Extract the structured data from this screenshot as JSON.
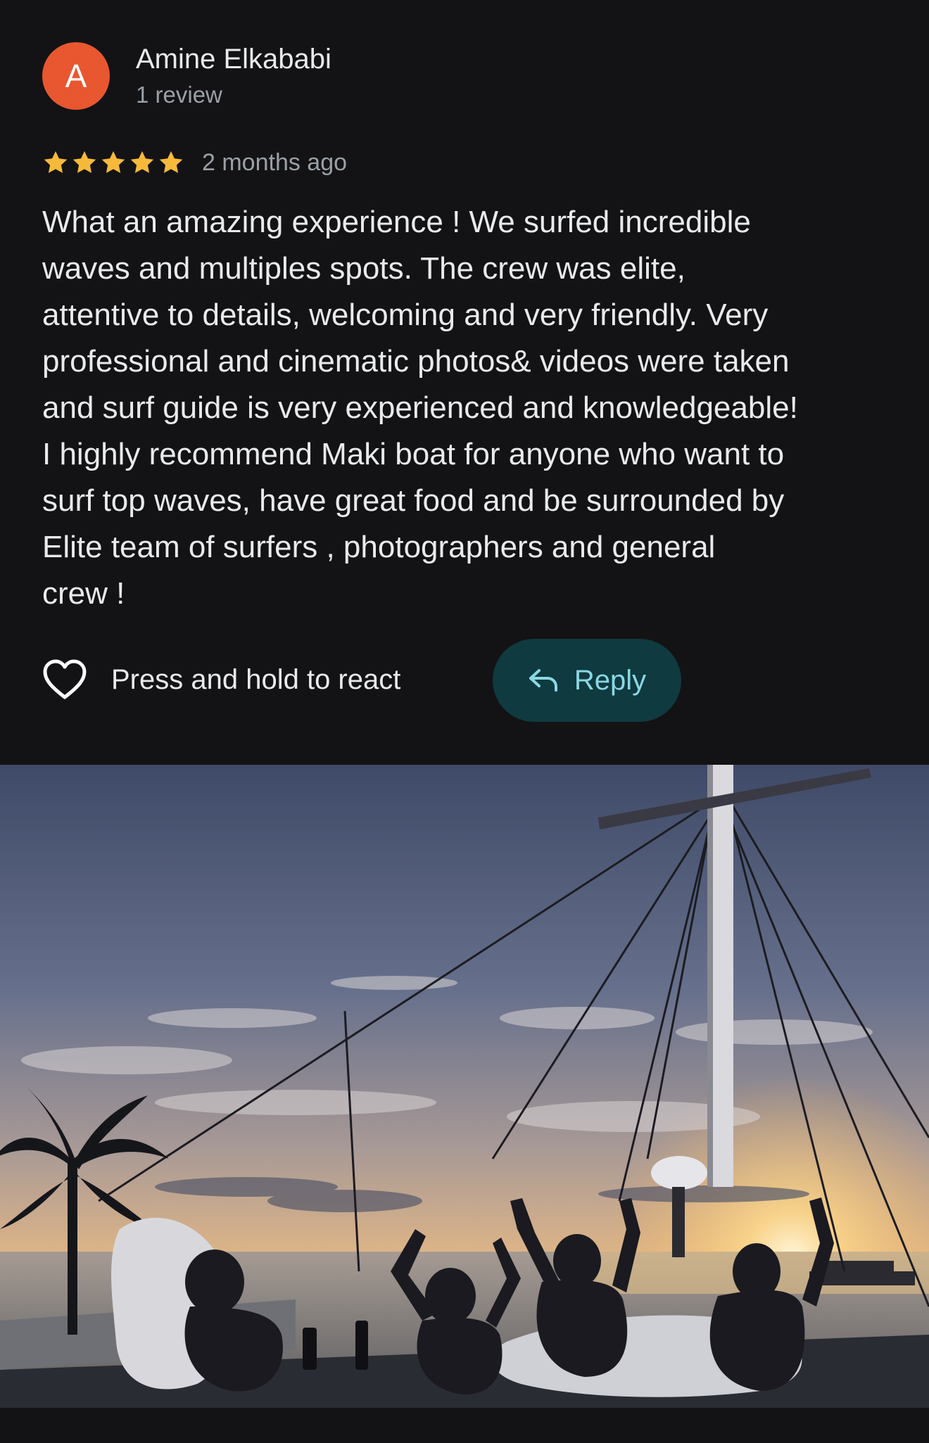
{
  "author": {
    "initial": "A",
    "name": "Amine Elkababi",
    "meta": "1 review",
    "avatar_color": "#e8572f"
  },
  "rating": {
    "stars": 5,
    "max": 5,
    "time_ago": "2 months ago",
    "star_color": "#f6b93b"
  },
  "review": {
    "text": "What an amazing experience ! We surfed incredible\nwaves and multiples spots. The crew was elite,\nattentive to details, welcoming and very friendly. Very\nprofessional and cinematic photos& videos were taken\nand surf guide is very experienced and knowledgeable!\nI highly recommend Maki boat for anyone who want to\nsurf top waves, have great food and be surrounded by\nElite team of surfers , photographers and general\ncrew !"
  },
  "actions": {
    "react_label": "Press and hold to react",
    "reply_label": "Reply",
    "react_icon": "heart-icon",
    "reply_icon": "reply-arrow-icon"
  },
  "photo": {
    "subject": "sunset-boat-deck-photo"
  }
}
